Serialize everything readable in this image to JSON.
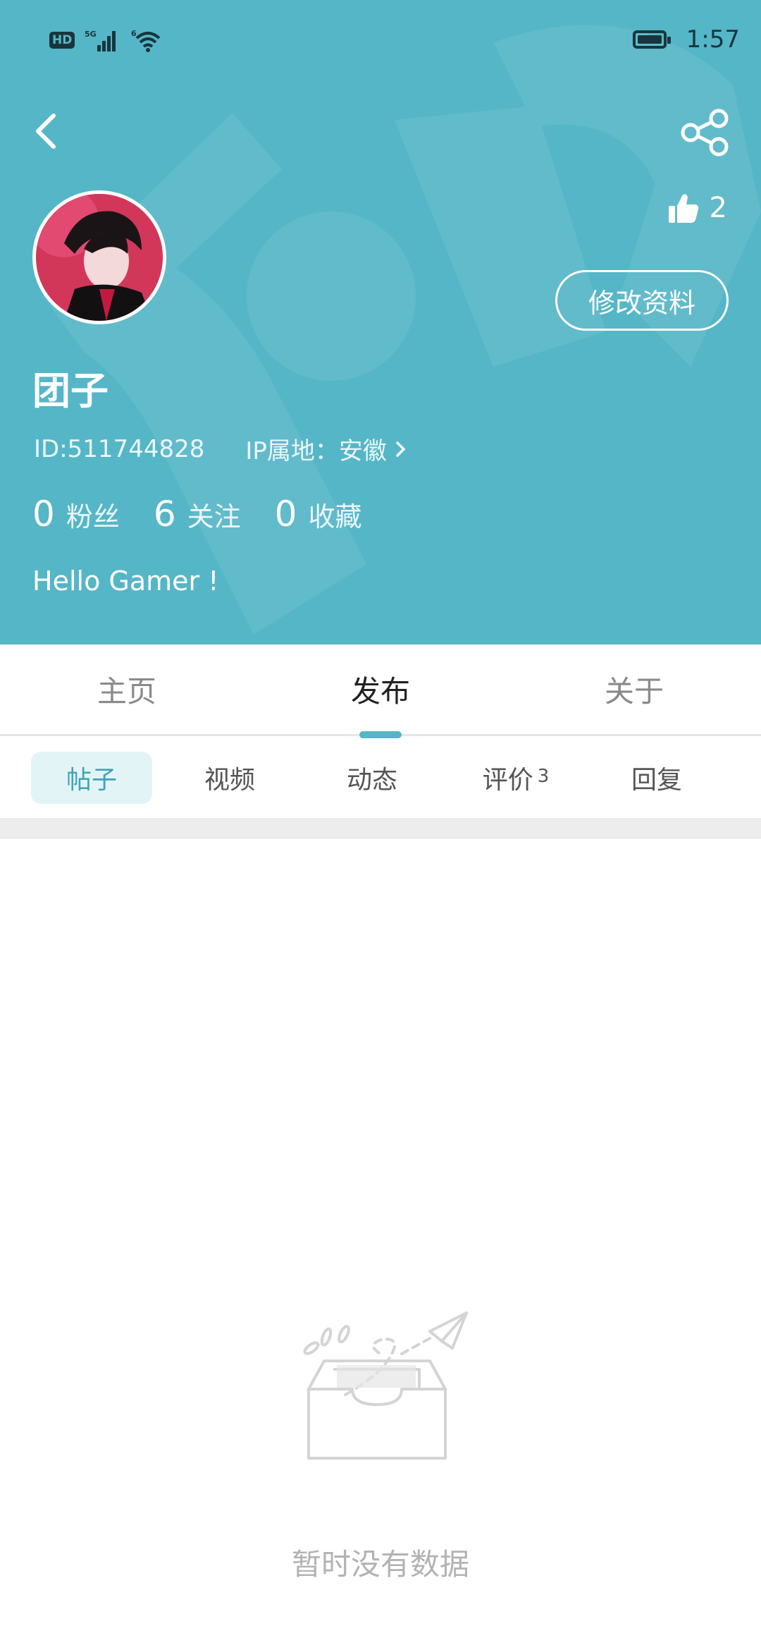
{
  "status_bar": {
    "network_badge": "HD",
    "time": "1:57"
  },
  "profile": {
    "nickname": "团子",
    "id_text": "ID:511744828",
    "ip_text": "IP属地：安徽",
    "likes": "2",
    "edit_label": "修改资料",
    "stats": [
      {
        "num": "0",
        "label": "粉丝"
      },
      {
        "num": "6",
        "label": "关注"
      },
      {
        "num": "0",
        "label": "收藏"
      }
    ],
    "bio": "Hello Gamer !"
  },
  "main_tabs": [
    {
      "label": "主页"
    },
    {
      "label": "发布"
    },
    {
      "label": "关于"
    }
  ],
  "sub_tabs": [
    {
      "label": "帖子"
    },
    {
      "label": "视频"
    },
    {
      "label": "动态"
    },
    {
      "label": "评价",
      "badge": "3"
    },
    {
      "label": "回复"
    }
  ],
  "empty_state": {
    "text": "暂时没有数据"
  },
  "colors": {
    "accent": "#55b6c7",
    "accent_text": "#3fa3b6"
  },
  "icons": [
    "back-icon",
    "share-icon",
    "thumbs-up-icon",
    "chevron-right-icon",
    "empty-inbox-icon"
  ]
}
